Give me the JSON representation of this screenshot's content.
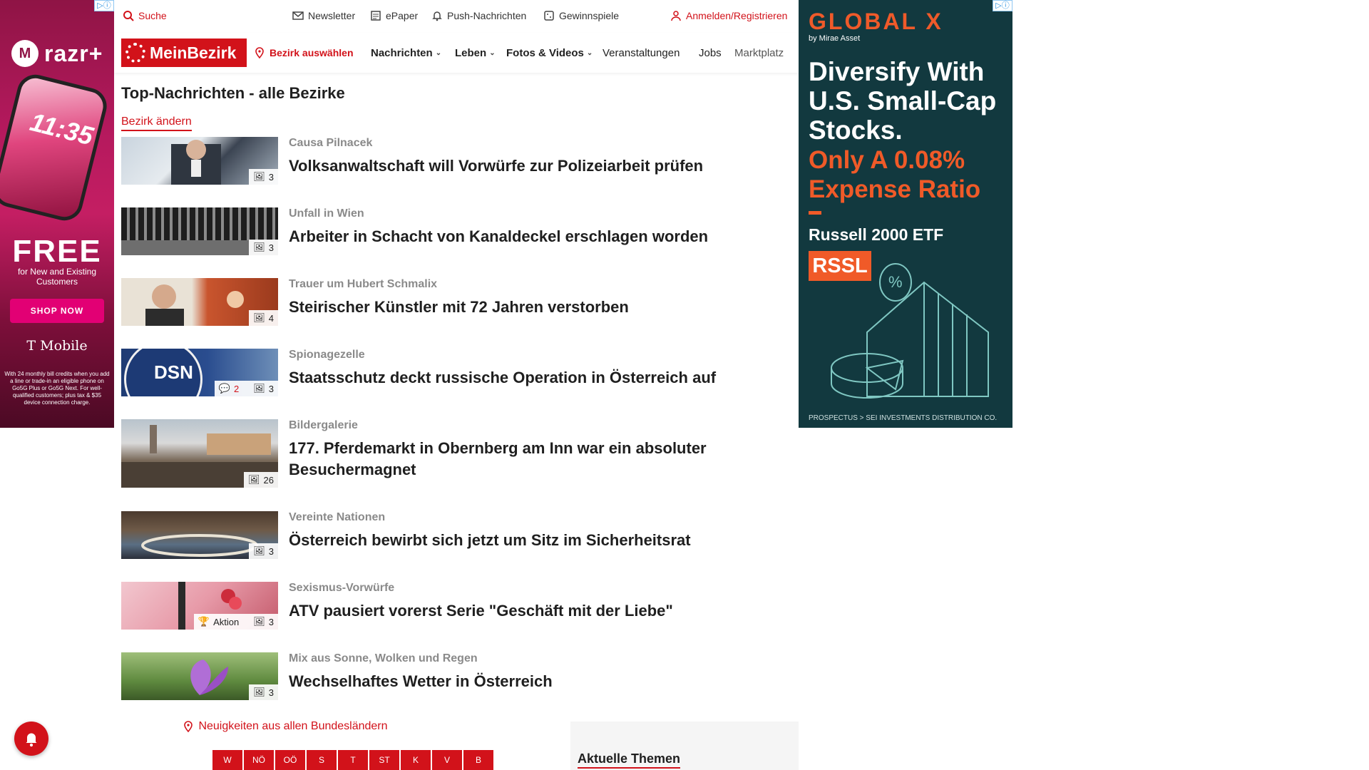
{
  "utility_bar": {
    "search": "Suche",
    "newsletter": "Newsletter",
    "epaper": "ePaper",
    "push": "Push-Nachrichten",
    "games": "Gewinnspiele",
    "login": "Anmelden/Registrieren"
  },
  "navbar": {
    "logo": "MeinBezirk",
    "bezirk": "Bezirk auswählen",
    "items": [
      "Nachrichten",
      "Leben",
      "Fotos & Videos",
      "Veranstaltungen",
      "Jobs",
      "Marktplatz"
    ]
  },
  "main": {
    "title": "Top-Nachrichten - alle Bezirke",
    "change_link": "Bezirk ändern",
    "articles": [
      {
        "kicker": "Causa Pilnacek",
        "headline": "Volksanwaltschaft will Vorwürfe zur Polizeiarbeit prüfen",
        "images": "3"
      },
      {
        "kicker": "Unfall in Wien",
        "headline": "Arbeiter in Schacht von Kanaldeckel erschlagen worden",
        "images": "3"
      },
      {
        "kicker": "Trauer um Hubert Schmalix",
        "headline": "Steirischer Künstler mit 72 Jahren verstorben",
        "images": "4"
      },
      {
        "kicker": "Spionagezelle",
        "headline": "Staatsschutz deckt russische Operation in Österreich auf",
        "images": "3",
        "comments": "2",
        "thumb_text": "DSN"
      },
      {
        "kicker": "Bildergalerie",
        "headline": "177. Pferdemarkt in Obernberg am Inn war ein absoluter Besuchermagnet",
        "images": "26"
      },
      {
        "kicker": "Vereinte Nationen",
        "headline": "Österreich bewirbt sich jetzt um Sitz im Sicherheitsrat",
        "images": "3"
      },
      {
        "kicker": "Sexismus-Vorwürfe",
        "headline": "ATV pausiert vorerst Serie \"Geschäft mit der Liebe\"",
        "images": "3",
        "promo": "Aktion"
      },
      {
        "kicker": "Mix aus Sonne, Wolken und Regen",
        "headline": "Wechselhaftes Wetter in Österreich",
        "images": "3"
      }
    ]
  },
  "states_section": {
    "link": "Neuigkeiten aus allen Bundesländern",
    "tabs": [
      "W",
      "NÖ",
      "OÖ",
      "S",
      "T",
      "ST",
      "K",
      "V",
      "B"
    ]
  },
  "topics": {
    "title": "Aktuelle Themen"
  },
  "ad_left": {
    "brand": "razr+",
    "time": "11:35",
    "headline": "FREE",
    "sub": "for New and Existing Customers",
    "cta": "SHOP NOW",
    "advertiser": "T Mobile",
    "fine_print": "With 24 monthly bill credits when you add a line or trade-in an eligible phone on Go5G Plus or Go5G Next. For well-qualified customers; plus tax & $35 device connection charge."
  },
  "ad_right": {
    "logo": "GLOBAL X",
    "logo_sub": "by Mirae Asset",
    "headline": "Diversify With U.S. Small-Cap Stocks.",
    "offer": "Only A 0.08% Expense Ratio",
    "product": "Russell 2000 ETF",
    "ticker": "RSSL",
    "footer": "PROSPECTUS > SEI INVESTMENTS DISTRIBUTION CO."
  },
  "colors": {
    "brand_red": "#d2121a",
    "ad_right_bg": "#12393f",
    "ad_right_accent": "#f05a28",
    "ad_left_bg": "#b4195d"
  }
}
